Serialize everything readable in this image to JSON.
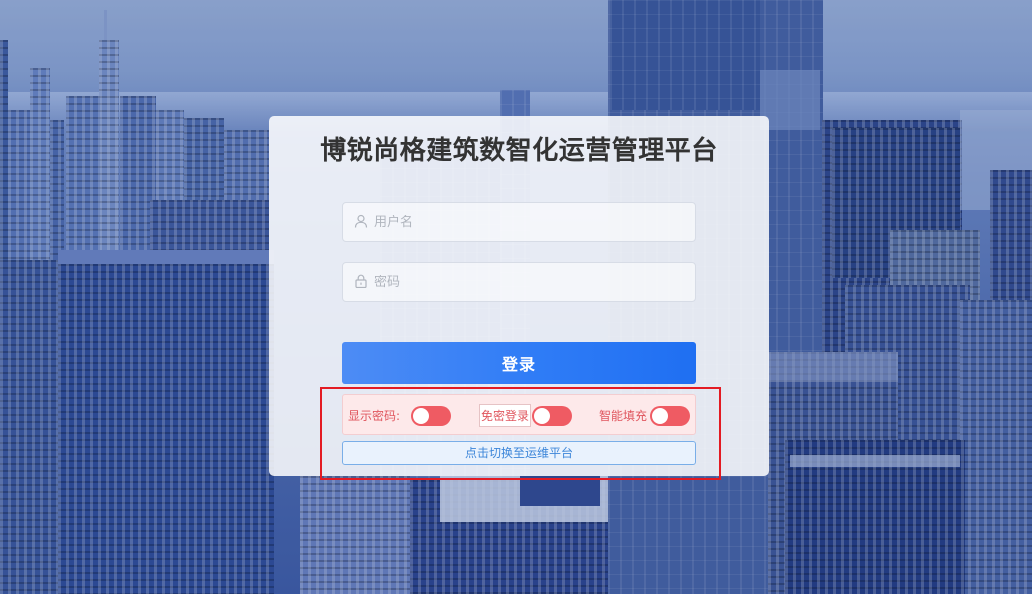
{
  "title": "博锐尚格建筑数智化运营管理平台",
  "form": {
    "username_placeholder": "用户名",
    "password_placeholder": "密码",
    "login_label": "登录"
  },
  "options": {
    "show_password_label": "显示密码:",
    "show_password_on": false,
    "remember_label": "免密登录",
    "remember_on": false,
    "autofill_label": "智能填充",
    "autofill_on": false
  },
  "switch_platform_label": "点击切换至运维平台",
  "icons": {
    "username": "user-icon",
    "password": "lock-icon"
  },
  "colors": {
    "login_button": "#2f7cf6",
    "toggle_off": "#ef5b63",
    "option_text": "#e0565e",
    "switch_button_text": "#3d86d9",
    "highlight_box": "#e31b23"
  }
}
